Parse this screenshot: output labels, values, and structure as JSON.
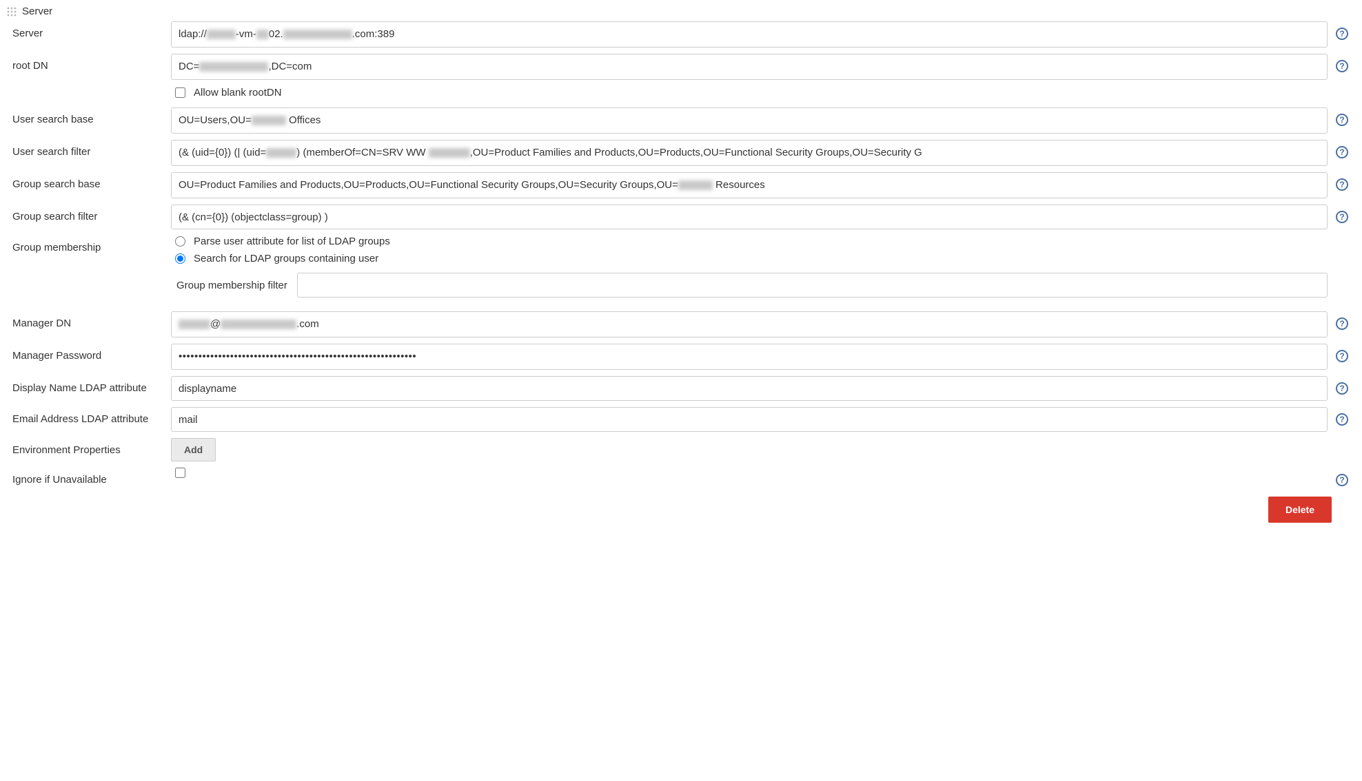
{
  "section": {
    "title": "Server"
  },
  "labels": {
    "server": "Server",
    "root_dn": "root DN",
    "allow_blank_root_dn": "Allow blank rootDN",
    "user_search_base": "User search base",
    "user_search_filter": "User search filter",
    "group_search_base": "Group search base",
    "group_search_filter": "Group search filter",
    "group_membership": "Group membership",
    "radio_parse": "Parse user attribute for list of LDAP groups",
    "radio_search": "Search for LDAP groups containing user",
    "group_membership_filter": "Group membership filter",
    "manager_dn": "Manager DN",
    "manager_password": "Manager Password",
    "display_name_attr": "Display Name LDAP attribute",
    "email_attr": "Email Address LDAP attribute",
    "env_props": "Environment Properties",
    "ignore_if_unavailable": "Ignore if Unavailable"
  },
  "buttons": {
    "add": "Add",
    "delete": "Delete"
  },
  "values": {
    "server": {
      "pre": "ldap://",
      "mid1": "-vm-",
      "mid2": "02.",
      "suffix": ".com:389"
    },
    "root_dn": {
      "pre": "DC=",
      "suffix": ",DC=com"
    },
    "allow_blank_root_dn": false,
    "user_search_base": {
      "pre": "OU=Users,OU=",
      "suffix": " Offices"
    },
    "user_search_filter": {
      "pre": "(& (uid={0}) (| (uid=",
      "mid1": ") (memberOf=CN=SRV WW ",
      "suffix": ",OU=Product Families and Products,OU=Products,OU=Functional Security Groups,OU=Security G"
    },
    "group_search_base": {
      "pre": "OU=Product Families and Products,OU=Products,OU=Functional Security Groups,OU=Security Groups,OU=",
      "suffix": " Resources"
    },
    "group_search_filter": "(& (cn={0}) (objectclass=group) )",
    "group_membership_selected": "search",
    "group_membership_filter": "",
    "manager_dn": {
      "mid": "@",
      "suffix": ".com"
    },
    "manager_password_masked": "••••••••••••••••••••••••••••••••••••••••••••••••••••••••••••",
    "display_name_attr": "displayname",
    "email_attr": "mail",
    "ignore_if_unavailable": false
  }
}
